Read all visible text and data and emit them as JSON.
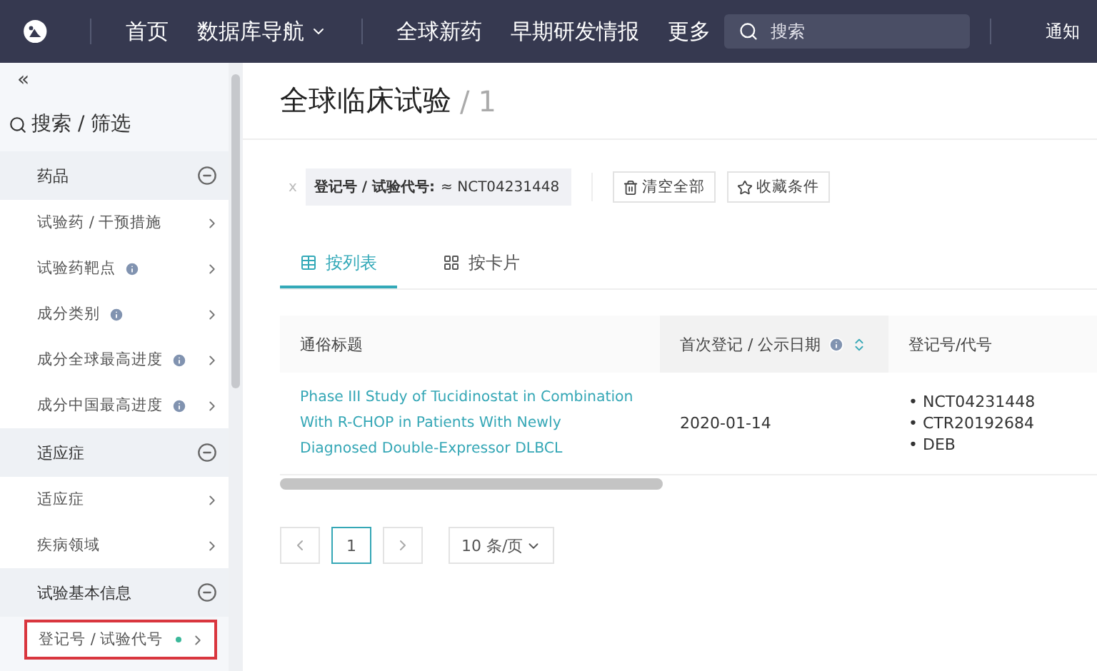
{
  "nav": {
    "items": [
      {
        "label": "首页",
        "dropdown": false
      },
      {
        "label": "数据库导航",
        "dropdown": true
      },
      {
        "label": "全球新药",
        "dropdown": false
      },
      {
        "label": "早期研发情报",
        "dropdown": false
      },
      {
        "label": "更多",
        "dropdown": false
      }
    ],
    "search": {
      "placeholder": "搜索"
    },
    "notice": "通知"
  },
  "sidebar": {
    "collapse": "«",
    "title": "搜索 / 筛选",
    "groups": [
      {
        "title": "药品",
        "expanded": true,
        "items": [
          {
            "label": "试验药 / 干预措施",
            "info": false,
            "marked": false,
            "highlighted": false
          },
          {
            "label": "试验药靶点",
            "info": true,
            "marked": false,
            "highlighted": false
          },
          {
            "label": "成分类别",
            "info": true,
            "marked": false,
            "highlighted": false
          },
          {
            "label": "成分全球最高进度",
            "info": true,
            "marked": false,
            "highlighted": false
          },
          {
            "label": "成分中国最高进度",
            "info": true,
            "marked": false,
            "highlighted": false
          }
        ]
      },
      {
        "title": "适应症",
        "expanded": true,
        "items": [
          {
            "label": "适应症",
            "info": false,
            "marked": false,
            "highlighted": false
          },
          {
            "label": "疾病领域",
            "info": false,
            "marked": false,
            "highlighted": false
          }
        ]
      },
      {
        "title": "试验基本信息",
        "expanded": true,
        "items": [
          {
            "label": "登记号 / 试验代号",
            "info": false,
            "marked": true,
            "highlighted": true
          }
        ]
      }
    ]
  },
  "page": {
    "title": "全球临床试验",
    "separator": "/",
    "count": "1"
  },
  "filter": {
    "remove": "x",
    "label": "登记号 / 试验代号:",
    "value": "≈ NCT04231448"
  },
  "actions": [
    {
      "kind": "trash",
      "label": "清空全部"
    },
    {
      "kind": "star",
      "label": "收藏条件"
    }
  ],
  "tabs": [
    {
      "kind": "list",
      "label": "按列表",
      "selected": true
    },
    {
      "kind": "cards",
      "label": "按卡片",
      "selected": false
    }
  ],
  "table": {
    "columns": [
      {
        "label": "通俗标题",
        "info": false,
        "sortable": false
      },
      {
        "label": "首次登记 / 公示日期",
        "info": true,
        "sortable": true
      },
      {
        "label": "登记号/代号",
        "info": false,
        "sortable": false
      }
    ],
    "rows": [
      {
        "title": "Phase III Study of Tucidinostat in Combination With R-CHOP in Patients With Newly Diagnosed Double-Expressor DLBCL",
        "date": "2020-01-14",
        "ids": [
          "• NCT04231448",
          "• CTR20192684",
          "• DEB"
        ]
      }
    ]
  },
  "pagination": {
    "pages": [
      {
        "label": "1",
        "selected": true
      }
    ],
    "page_size": "10 条/页"
  }
}
